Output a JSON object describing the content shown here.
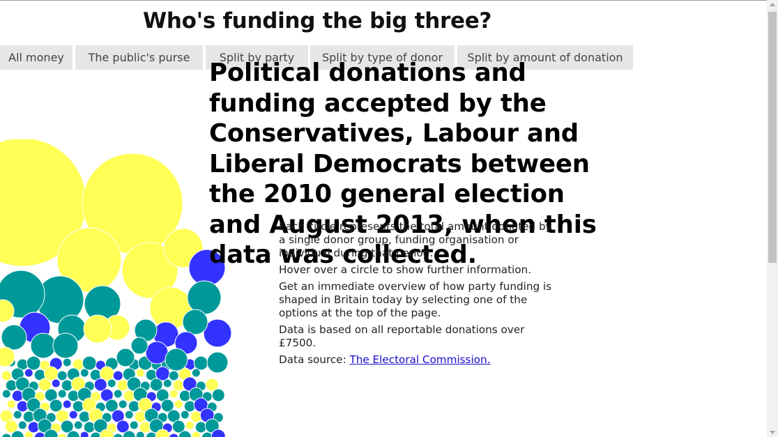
{
  "header": {
    "title": "Who's funding the big three?"
  },
  "nav": {
    "items": [
      {
        "label": "All money"
      },
      {
        "label": "The public's purse"
      },
      {
        "label": "Split by party"
      },
      {
        "label": "Split by type of donor"
      },
      {
        "label": "Split by amount of donation"
      }
    ]
  },
  "main": {
    "headline": "Political donations and funding accepted by the Conservatives, Labour and Liberal Democrats between the 2010 general election and August 2013, when this data was collected.",
    "paragraphs": [
      "Each circle represents the total amount donated by a single donor group, funding organisation or individual during that period.",
      "Hover over a circle to show further information.",
      "Get an immediate overview of how party funding is shaped in Britain today by selecting one of the options at the top of the page.",
      "Data is based on all reportable donations over £7500."
    ],
    "source_prefix": "Data source: ",
    "source_link": "The Electoral Commission."
  },
  "colors": {
    "libdem": "#ffff55",
    "labour": "#3333ff",
    "conservative": "#009999"
  }
}
